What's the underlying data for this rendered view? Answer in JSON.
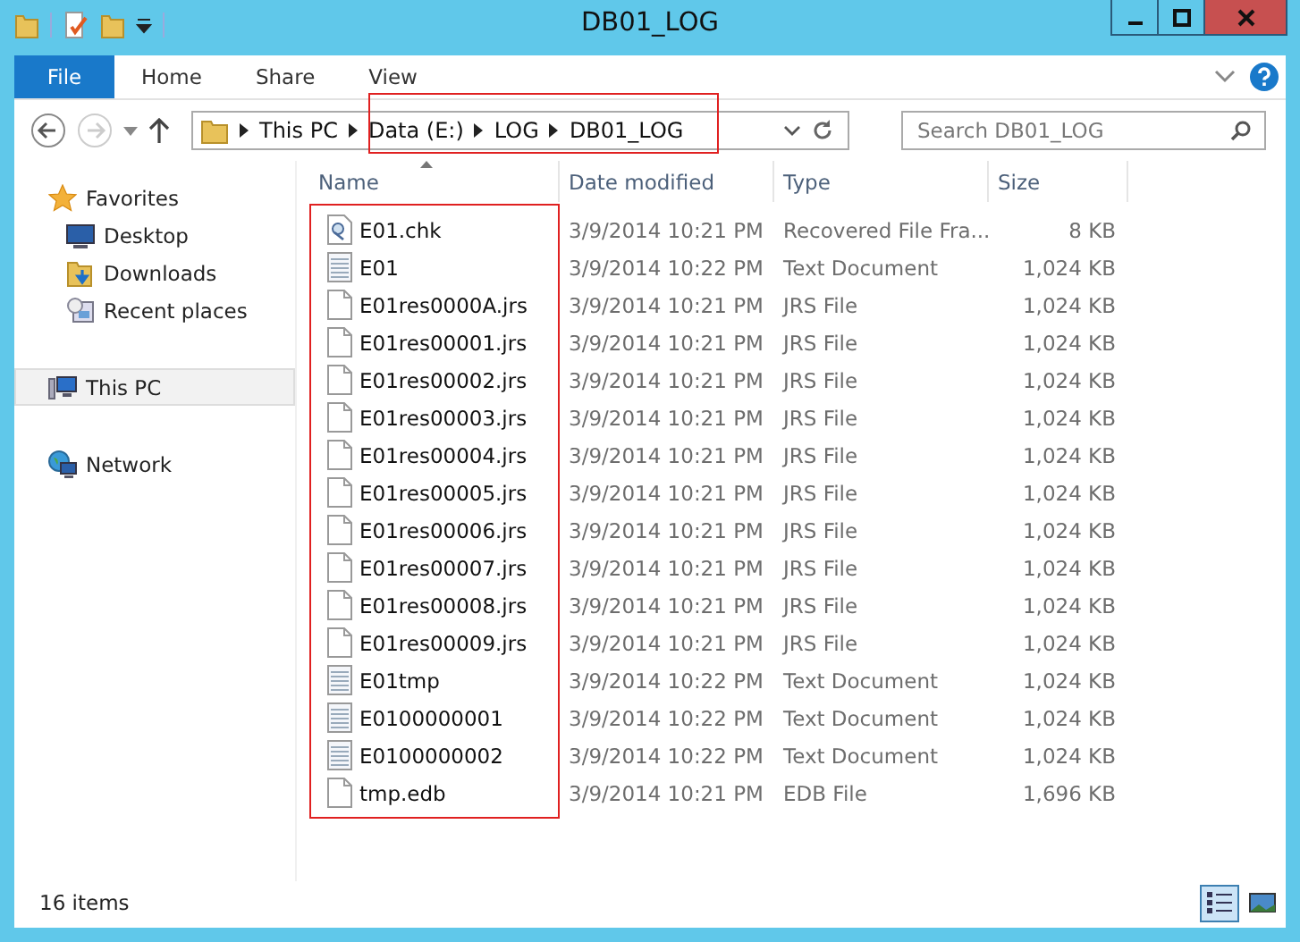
{
  "window": {
    "title": "DB01_LOG"
  },
  "ribbon_tabs": [
    {
      "label": "File",
      "kind": "file"
    },
    {
      "label": "Home",
      "kind": "tab"
    },
    {
      "label": "Share",
      "kind": "tab"
    },
    {
      "label": "View",
      "kind": "tab"
    }
  ],
  "address": {
    "crumbs": [
      "This PC",
      "Data (E:)",
      "LOG",
      "DB01_LOG"
    ]
  },
  "search": {
    "placeholder": "Search DB01_LOG"
  },
  "sidebar": {
    "items": [
      {
        "label": "Favorites",
        "kind": "star",
        "selected": false,
        "children": [
          {
            "label": "Desktop",
            "kind": "desktop",
            "selected": false
          },
          {
            "label": "Downloads",
            "kind": "downloads",
            "selected": false
          },
          {
            "label": "Recent places",
            "kind": "recent",
            "selected": false
          }
        ]
      },
      {
        "label": "This PC",
        "kind": "pc",
        "selected": true
      },
      {
        "label": "Network",
        "kind": "network",
        "selected": false
      }
    ]
  },
  "table": {
    "columns": [
      "Name",
      "Date modified",
      "Type",
      "Size"
    ],
    "rows": [
      {
        "kind": "chk",
        "name": "E01.chk",
        "date": "3/9/2014 10:21 PM",
        "type": "Recovered File Fra...",
        "size": "8 KB"
      },
      {
        "kind": "text",
        "name": "E01",
        "date": "3/9/2014 10:22 PM",
        "type": "Text Document",
        "size": "1,024 KB"
      },
      {
        "kind": "file",
        "name": "E01res0000A.jrs",
        "date": "3/9/2014 10:21 PM",
        "type": "JRS File",
        "size": "1,024 KB"
      },
      {
        "kind": "file",
        "name": "E01res00001.jrs",
        "date": "3/9/2014 10:21 PM",
        "type": "JRS File",
        "size": "1,024 KB"
      },
      {
        "kind": "file",
        "name": "E01res00002.jrs",
        "date": "3/9/2014 10:21 PM",
        "type": "JRS File",
        "size": "1,024 KB"
      },
      {
        "kind": "file",
        "name": "E01res00003.jrs",
        "date": "3/9/2014 10:21 PM",
        "type": "JRS File",
        "size": "1,024 KB"
      },
      {
        "kind": "file",
        "name": "E01res00004.jrs",
        "date": "3/9/2014 10:21 PM",
        "type": "JRS File",
        "size": "1,024 KB"
      },
      {
        "kind": "file",
        "name": "E01res00005.jrs",
        "date": "3/9/2014 10:21 PM",
        "type": "JRS File",
        "size": "1,024 KB"
      },
      {
        "kind": "file",
        "name": "E01res00006.jrs",
        "date": "3/9/2014 10:21 PM",
        "type": "JRS File",
        "size": "1,024 KB"
      },
      {
        "kind": "file",
        "name": "E01res00007.jrs",
        "date": "3/9/2014 10:21 PM",
        "type": "JRS File",
        "size": "1,024 KB"
      },
      {
        "kind": "file",
        "name": "E01res00008.jrs",
        "date": "3/9/2014 10:21 PM",
        "type": "JRS File",
        "size": "1,024 KB"
      },
      {
        "kind": "file",
        "name": "E01res00009.jrs",
        "date": "3/9/2014 10:21 PM",
        "type": "JRS File",
        "size": "1,024 KB"
      },
      {
        "kind": "text",
        "name": "E01tmp",
        "date": "3/9/2014 10:22 PM",
        "type": "Text Document",
        "size": "1,024 KB"
      },
      {
        "kind": "text",
        "name": "E0100000001",
        "date": "3/9/2014 10:22 PM",
        "type": "Text Document",
        "size": "1,024 KB"
      },
      {
        "kind": "text",
        "name": "E0100000002",
        "date": "3/9/2014 10:22 PM",
        "type": "Text Document",
        "size": "1,024 KB"
      },
      {
        "kind": "file",
        "name": "tmp.edb",
        "date": "3/9/2014 10:21 PM",
        "type": "EDB File",
        "size": "1,696 KB"
      }
    ]
  },
  "status_bar": {
    "count": "16 items",
    "views": [
      {
        "kind": "details",
        "selected": true
      },
      {
        "kind": "thumbs",
        "selected": false
      }
    ]
  }
}
